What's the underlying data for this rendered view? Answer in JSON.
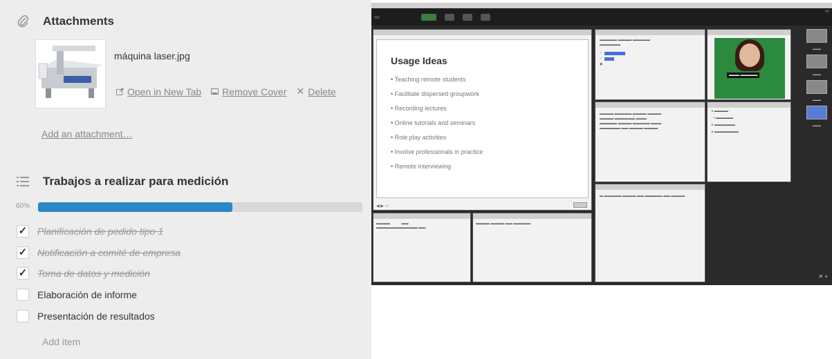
{
  "attachments": {
    "title": "Attachments",
    "file_name": "máquina laser.jpg",
    "actions": {
      "open": "Open in New Tab",
      "remove_cover": "Remove Cover",
      "delete": "Delete"
    },
    "add_link": "Add an attachment…"
  },
  "checklist": {
    "title": "Trabajos a realizar para medición",
    "progress_label": "60%",
    "progress_fraction": 0.6,
    "items": [
      {
        "text": "Planificación de pedido tipo 1",
        "done": true
      },
      {
        "text": "Notificación a comité de empresa",
        "done": true
      },
      {
        "text": "Toma de datos y medición",
        "done": true
      },
      {
        "text": "Elaboración de informe",
        "done": false
      },
      {
        "text": "Presentación de resultados",
        "done": false
      }
    ],
    "add_item": "Add item"
  },
  "connect": {
    "share_title": "Usage Ideas",
    "usage_ideas": [
      "Teaching remote students",
      "Facilitate dispersed groupwork",
      "Recording lectures",
      "Online tutorials and seminars",
      "Role play activities",
      "Involve professionals in practice",
      "Remote interviewing"
    ]
  },
  "colors": {
    "progress": "#2d86c5",
    "panel_bg": "#ededed"
  }
}
